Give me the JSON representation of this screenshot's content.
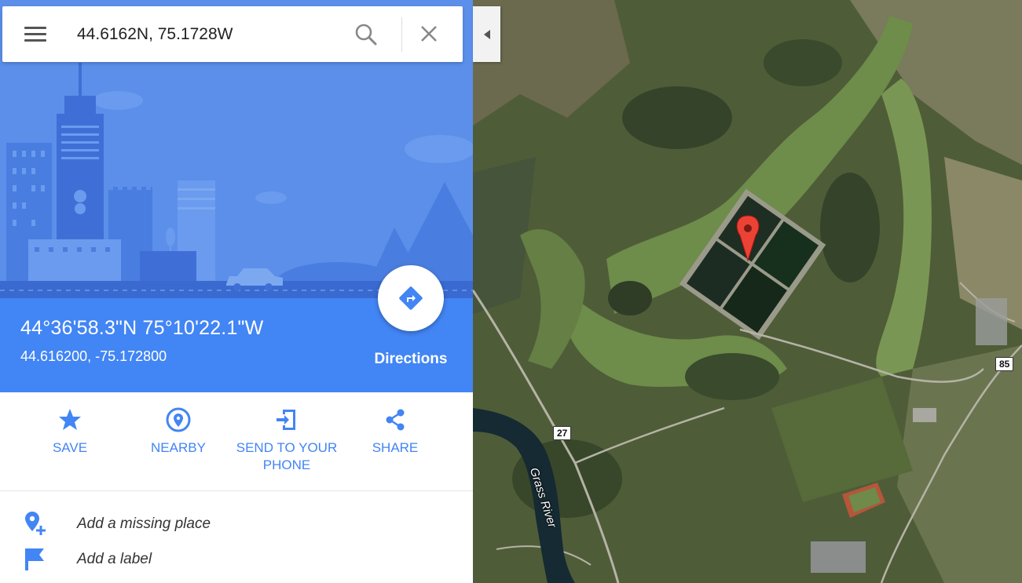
{
  "search": {
    "query": "44.6162N, 75.1728W",
    "menu_icon": "hamburger-menu-icon",
    "search_icon": "magnifier-icon",
    "clear_icon": "close-icon"
  },
  "place": {
    "dms": "44°36'58.3\"N 75°10'22.1\"W",
    "decimal": "44.616200, -75.172800",
    "directions_label": "Directions"
  },
  "actions": [
    {
      "label": "SAVE",
      "icon": "star-icon"
    },
    {
      "label": "NEARBY",
      "icon": "nearby-pin-icon"
    },
    {
      "label": "SEND TO YOUR PHONE",
      "icon": "send-to-phone-icon"
    },
    {
      "label": "SHARE",
      "icon": "share-icon"
    }
  ],
  "list": [
    {
      "label": "Add a missing place",
      "icon": "add-place-icon"
    },
    {
      "label": "Add a label",
      "icon": "flag-icon"
    }
  ],
  "map": {
    "route_shields": [
      "85",
      "27"
    ],
    "river_label": "Grass River",
    "marker_icon": "red-map-pin-icon"
  },
  "colors": {
    "accent": "#4285f4",
    "hero_bg": "#5a8ee9",
    "marker": "#ea4335"
  }
}
